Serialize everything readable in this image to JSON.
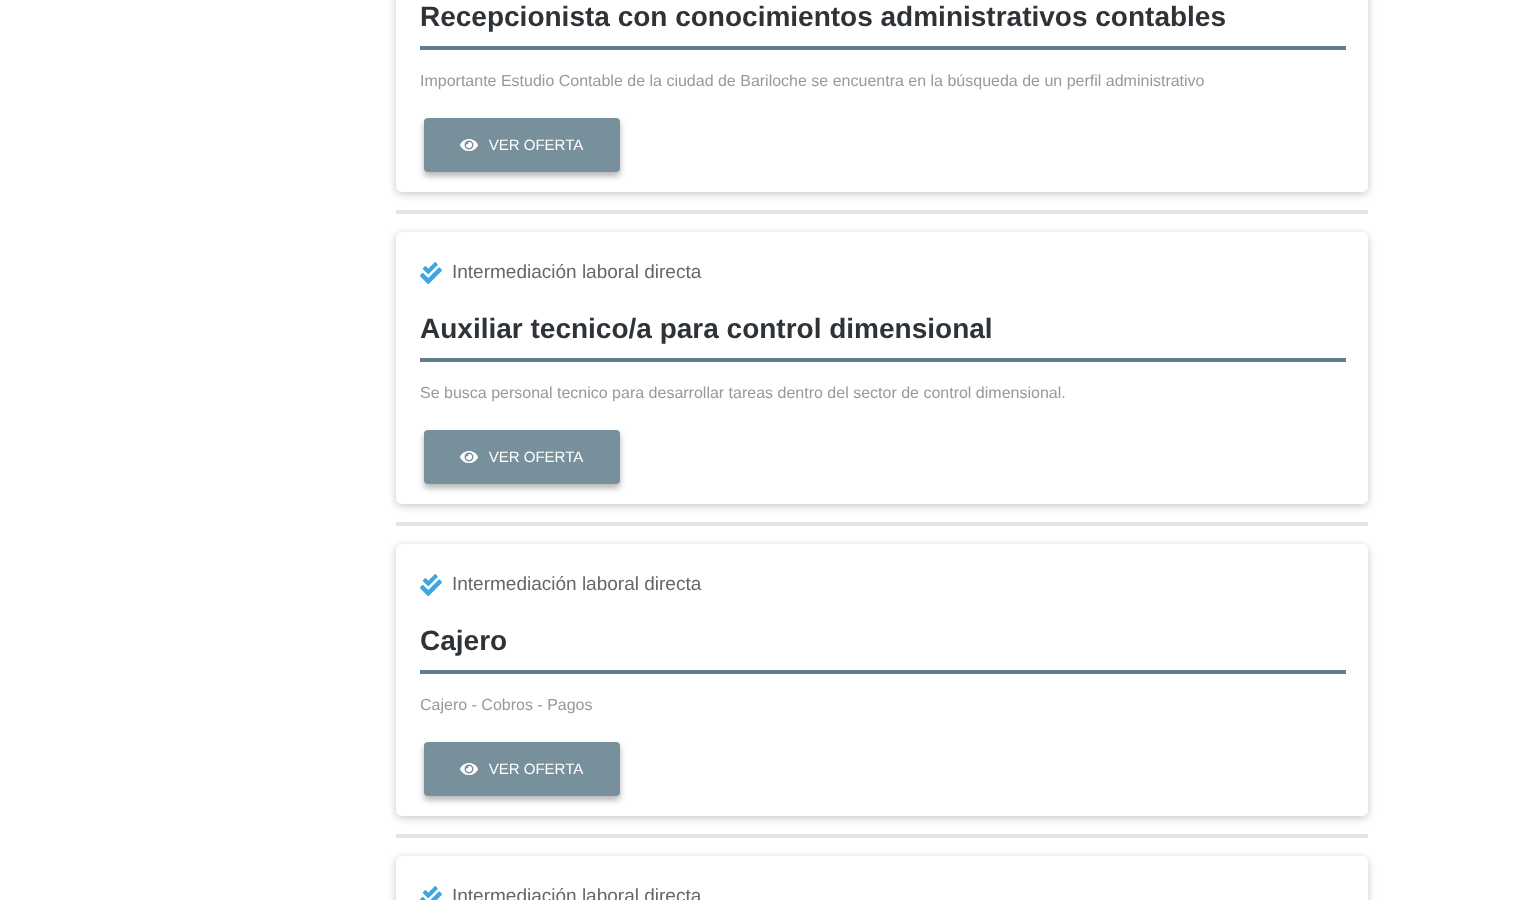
{
  "offers": [
    {
      "title": "Recepcionista con conocimientos administrativos contables",
      "description": "Importante Estudio Contable de la ciudad de Bariloche se encuentra en la búsqueda de un perfil administrativo",
      "button": "VER OFERTA"
    },
    {
      "tag": "Intermediación laboral directa",
      "title": "Auxiliar tecnico/a para control dimensional",
      "description": "Se busca personal tecnico para desarrollar tareas dentro del sector de control dimensional.",
      "button": "VER OFERTA"
    },
    {
      "tag": "Intermediación laboral directa",
      "title": "Cajero",
      "description": "Cajero - Cobros - Pagos",
      "button": "VER OFERTA"
    },
    {
      "tag": "Intermediación laboral directa"
    }
  ]
}
